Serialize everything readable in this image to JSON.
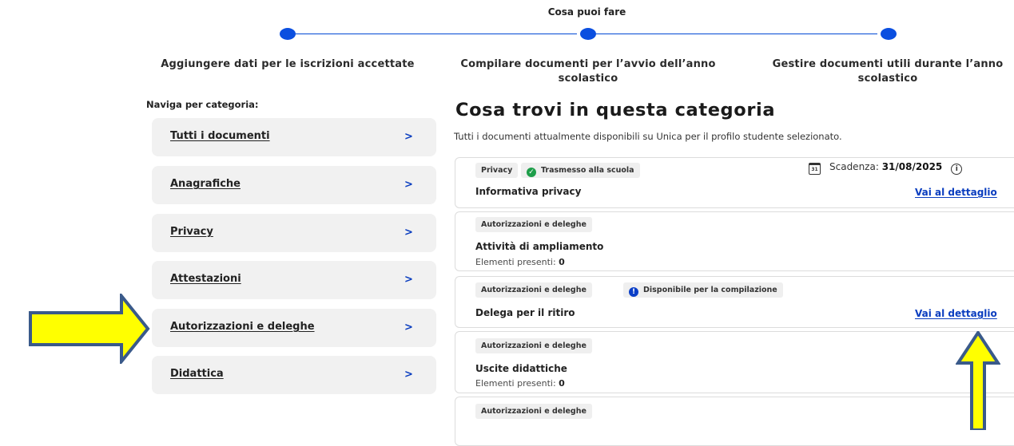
{
  "stepper": {
    "title": "Cosa puoi fare",
    "steps": [
      {
        "label": "Aggiungere dati per le iscrizioni accettate"
      },
      {
        "label": "Compilare documenti per l’avvio dell’anno scolastico"
      },
      {
        "label": "Gestire documenti utili durante l’anno scolastico"
      }
    ]
  },
  "sidebar": {
    "heading": "Naviga per categoria:",
    "items": [
      {
        "label": "Tutti i documenti",
        "chevron": ">"
      },
      {
        "label": "Anagrafiche",
        "chevron": ">"
      },
      {
        "label": "Privacy",
        "chevron": ">"
      },
      {
        "label": "Attestazioni",
        "chevron": ">"
      },
      {
        "label": "Autorizzazioni e deleghe",
        "chevron": ">"
      },
      {
        "label": "Didattica",
        "chevron": ">"
      }
    ]
  },
  "main": {
    "title": "Cosa trovi in questa categoria",
    "subtitle": "Tutti i documenti attualmente disponibili su Unica per il profilo studente selezionato.",
    "cards": [
      {
        "category": "Privacy",
        "status": "Trasmesso alla scuola",
        "status_icon": "check-circle-icon",
        "deadline_label": "Scadenza:",
        "deadline_value": "31/08/2025",
        "calendar_day": "31",
        "title": "Informativa privacy",
        "link": "Vai al dettaglio"
      },
      {
        "category": "Autorizzazioni e deleghe",
        "title": "Attività di ampliamento",
        "count_label": "Elementi presenti:",
        "count_value": "0"
      },
      {
        "category": "Autorizzazioni e deleghe",
        "status": "Disponibile per la compilazione",
        "status_icon": "exclamation-circle-icon",
        "title": "Delega per il ritiro",
        "link": "Vai al dettaglio"
      },
      {
        "category": "Autorizzazioni e deleghe",
        "title": "Uscite didattiche",
        "count_label": "Elementi presenti:",
        "count_value": "0"
      },
      {
        "category": "Autorizzazioni e deleghe"
      }
    ]
  },
  "colors": {
    "accent": "#0b4fe0",
    "link": "#0a3dbf",
    "success": "#1e9e4a",
    "annotation_arrow_fill": "#ffff00",
    "annotation_arrow_stroke": "#3a5a8a"
  }
}
